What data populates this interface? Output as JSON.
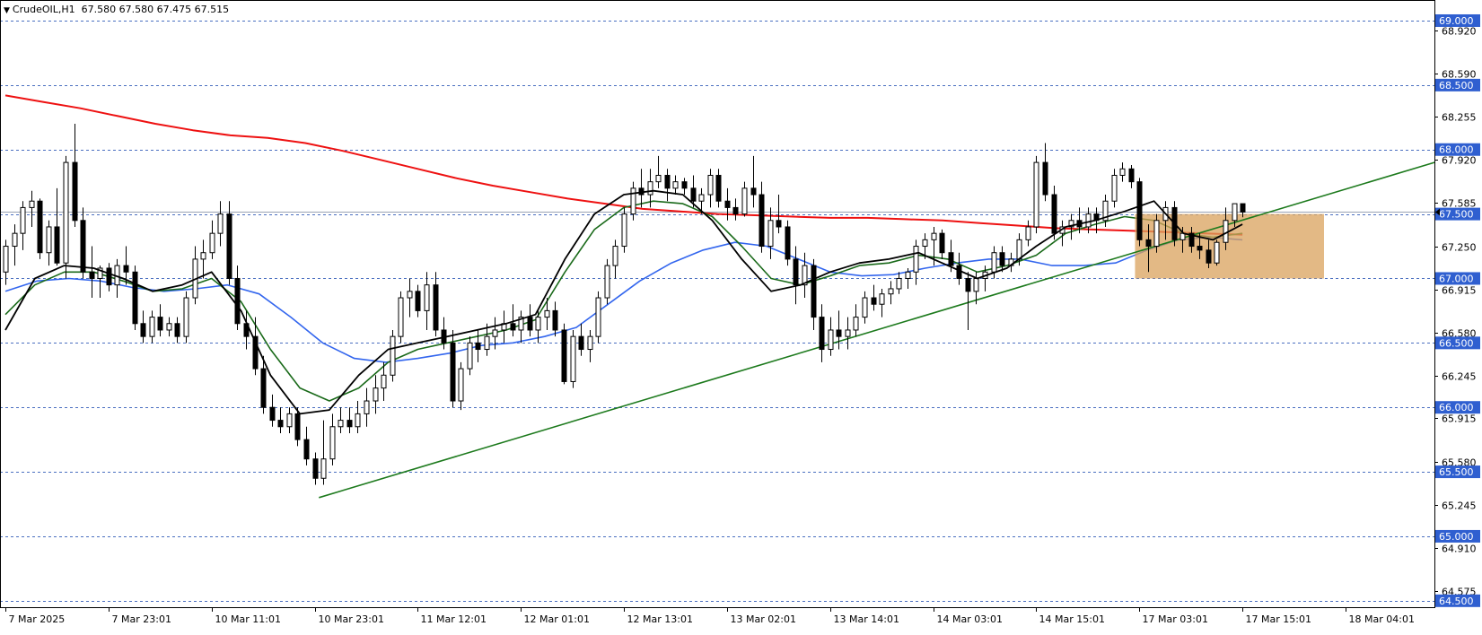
{
  "header": {
    "menu_arrow": "▼",
    "symbol_label": "CrudeOIL,H1",
    "ohlc": "67.580 67.580 67.475 67.515"
  },
  "colors": {
    "bull": "#ffffff",
    "bear": "#000000",
    "ma_red": "#ee1111",
    "ma_blue": "#3366ee",
    "ma_green": "#1a6a1a",
    "ma_black": "#000000",
    "trendline": "#1d7a1d",
    "zone": "#d9a15c",
    "grid_dash": "#4a6fc0",
    "badge": "#2f5fd0"
  },
  "chart_data": {
    "type": "candlestick",
    "symbol": "CrudeOIL",
    "timeframe": "H1",
    "ylim": [
      64.45,
      69.16
    ],
    "y_tick_labels": [
      "68.920",
      "68.590",
      "68.255",
      "67.920",
      "67.585",
      "67.250",
      "66.915",
      "66.580",
      "66.245",
      "65.915",
      "65.580",
      "65.245",
      "64.910",
      "64.575"
    ],
    "y_tick_values": [
      68.92,
      68.59,
      68.255,
      67.92,
      67.585,
      67.25,
      66.915,
      66.58,
      66.245,
      65.915,
      65.58,
      65.245,
      64.91,
      64.575
    ],
    "level_lines": [
      69.0,
      68.5,
      68.0,
      67.5,
      67.0,
      66.5,
      66.0,
      65.5,
      65.0,
      64.5
    ],
    "level_labels": [
      "69.000",
      "68.500",
      "68.000",
      "67.500",
      "67.000",
      "66.500",
      "66.000",
      "65.500",
      "65.000",
      "64.500"
    ],
    "current_price": 67.515,
    "x_labels": [
      "7 Mar 2025",
      "7 Mar 23:01",
      "10 Mar 11:01",
      "10 Mar 23:01",
      "11 Mar 12:01",
      "12 Mar 01:01",
      "12 Mar 13:01",
      "13 Mar 02:01",
      "13 Mar 14:01",
      "14 Mar 03:01",
      "14 Mar 15:01",
      "17 Mar 03:01",
      "17 Mar 15:01",
      "18 Mar 04:01"
    ],
    "x_label_bar_index": [
      0,
      12,
      24,
      36,
      48,
      60,
      72,
      84,
      96,
      108,
      120,
      132,
      144,
      156
    ],
    "candles": [
      [
        67.05,
        67.3,
        66.95,
        67.25
      ],
      [
        67.25,
        67.42,
        67.1,
        67.35
      ],
      [
        67.35,
        67.6,
        67.22,
        67.55
      ],
      [
        67.55,
        67.68,
        67.4,
        67.6
      ],
      [
        67.6,
        67.62,
        67.15,
        67.2
      ],
      [
        67.2,
        67.45,
        67.1,
        67.4
      ],
      [
        67.4,
        67.7,
        67.1,
        67.12
      ],
      [
        67.12,
        67.95,
        67.0,
        67.9
      ],
      [
        67.9,
        68.2,
        67.4,
        67.45
      ],
      [
        67.45,
        67.55,
        67.0,
        67.05
      ],
      [
        67.05,
        67.25,
        66.85,
        67.0
      ],
      [
        67.0,
        67.1,
        66.85,
        67.08
      ],
      [
        67.08,
        67.12,
        66.9,
        66.95
      ],
      [
        66.95,
        67.15,
        66.85,
        67.1
      ],
      [
        67.1,
        67.25,
        66.95,
        67.05
      ],
      [
        67.05,
        67.1,
        66.6,
        66.65
      ],
      [
        66.65,
        66.75,
        66.5,
        66.55
      ],
      [
        66.55,
        66.75,
        66.5,
        66.7
      ],
      [
        66.7,
        66.8,
        66.55,
        66.6
      ],
      [
        66.6,
        66.7,
        66.55,
        66.65
      ],
      [
        66.65,
        66.7,
        66.5,
        66.55
      ],
      [
        66.55,
        66.9,
        66.5,
        66.85
      ],
      [
        66.85,
        67.25,
        66.8,
        67.15
      ],
      [
        67.15,
        67.3,
        67.0,
        67.2
      ],
      [
        67.2,
        67.45,
        67.15,
        67.35
      ],
      [
        67.35,
        67.6,
        67.25,
        67.5
      ],
      [
        67.5,
        67.6,
        66.95,
        67.0
      ],
      [
        67.0,
        67.1,
        66.6,
        66.65
      ],
      [
        66.65,
        66.75,
        66.45,
        66.55
      ],
      [
        66.55,
        66.7,
        66.25,
        66.3
      ],
      [
        66.3,
        66.4,
        65.95,
        66.0
      ],
      [
        66.0,
        66.1,
        65.85,
        65.9
      ],
      [
        65.9,
        66.0,
        65.8,
        65.85
      ],
      [
        65.85,
        66.0,
        65.8,
        65.95
      ],
      [
        65.95,
        66.0,
        65.7,
        65.75
      ],
      [
        65.75,
        65.85,
        65.55,
        65.6
      ],
      [
        65.6,
        65.65,
        65.4,
        65.45
      ],
      [
        65.45,
        65.9,
        65.4,
        65.6
      ],
      [
        65.6,
        65.95,
        65.55,
        65.85
      ],
      [
        65.85,
        66.0,
        65.8,
        65.9
      ],
      [
        65.9,
        66.0,
        65.8,
        65.85
      ],
      [
        65.85,
        66.05,
        65.8,
        65.95
      ],
      [
        65.95,
        66.15,
        65.85,
        66.05
      ],
      [
        66.05,
        66.25,
        65.95,
        66.15
      ],
      [
        66.15,
        66.35,
        66.05,
        66.25
      ],
      [
        66.25,
        66.6,
        66.2,
        66.55
      ],
      [
        66.55,
        66.9,
        66.5,
        66.85
      ],
      [
        66.85,
        67.0,
        66.7,
        66.9
      ],
      [
        66.9,
        66.95,
        66.7,
        66.75
      ],
      [
        66.75,
        67.05,
        66.6,
        66.95
      ],
      [
        66.95,
        67.05,
        66.55,
        66.6
      ],
      [
        66.6,
        66.7,
        66.45,
        66.5
      ],
      [
        66.5,
        66.6,
        66.0,
        66.05
      ],
      [
        66.05,
        66.35,
        65.98,
        66.3
      ],
      [
        66.3,
        66.55,
        66.25,
        66.5
      ],
      [
        66.5,
        66.6,
        66.35,
        66.45
      ],
      [
        66.45,
        66.65,
        66.4,
        66.55
      ],
      [
        66.55,
        66.7,
        66.45,
        66.6
      ],
      [
        66.6,
        66.75,
        66.5,
        66.65
      ],
      [
        66.65,
        66.8,
        66.55,
        66.6
      ],
      [
        66.6,
        66.75,
        66.5,
        66.7
      ],
      [
        66.7,
        66.8,
        66.55,
        66.6
      ],
      [
        66.6,
        66.75,
        66.5,
        66.7
      ],
      [
        66.7,
        66.85,
        66.6,
        66.75
      ],
      [
        66.75,
        66.82,
        66.55,
        66.6
      ],
      [
        66.6,
        66.65,
        66.18,
        66.2
      ],
      [
        66.2,
        66.6,
        66.15,
        66.55
      ],
      [
        66.55,
        66.65,
        66.4,
        66.45
      ],
      [
        66.45,
        66.6,
        66.35,
        66.55
      ],
      [
        66.55,
        66.9,
        66.5,
        66.85
      ],
      [
        66.85,
        67.15,
        66.8,
        67.1
      ],
      [
        67.1,
        67.3,
        67.0,
        67.25
      ],
      [
        67.25,
        67.55,
        67.2,
        67.5
      ],
      [
        67.5,
        67.75,
        67.45,
        67.7
      ],
      [
        67.7,
        67.85,
        67.55,
        67.65
      ],
      [
        67.65,
        67.85,
        67.55,
        67.75
      ],
      [
        67.75,
        67.95,
        67.7,
        67.8
      ],
      [
        67.8,
        67.85,
        67.6,
        67.7
      ],
      [
        67.7,
        67.8,
        67.65,
        67.75
      ],
      [
        67.75,
        67.78,
        67.65,
        67.7
      ],
      [
        67.7,
        67.8,
        67.55,
        67.6
      ],
      [
        67.6,
        67.7,
        67.5,
        67.65
      ],
      [
        67.65,
        67.85,
        67.55,
        67.8
      ],
      [
        67.8,
        67.85,
        67.55,
        67.6
      ],
      [
        67.6,
        67.7,
        67.45,
        67.55
      ],
      [
        67.55,
        67.62,
        67.45,
        67.5
      ],
      [
        67.5,
        67.75,
        67.48,
        67.7
      ],
      [
        67.7,
        67.95,
        67.55,
        67.65
      ],
      [
        67.65,
        67.75,
        67.2,
        67.25
      ],
      [
        67.25,
        67.55,
        67.15,
        67.45
      ],
      [
        67.45,
        67.65,
        67.35,
        67.4
      ],
      [
        67.4,
        67.45,
        67.1,
        67.15
      ],
      [
        67.15,
        67.25,
        66.8,
        66.95
      ],
      [
        66.95,
        67.2,
        66.85,
        67.1
      ],
      [
        67.1,
        67.15,
        66.6,
        66.7
      ],
      [
        66.7,
        66.8,
        66.35,
        66.45
      ],
      [
        66.45,
        66.7,
        66.4,
        66.6
      ],
      [
        66.6,
        66.75,
        66.45,
        66.55
      ],
      [
        66.55,
        66.7,
        66.45,
        66.6
      ],
      [
        66.6,
        66.8,
        66.55,
        66.7
      ],
      [
        66.7,
        66.9,
        66.65,
        66.85
      ],
      [
        66.85,
        66.95,
        66.75,
        66.8
      ],
      [
        66.8,
        66.92,
        66.7,
        66.88
      ],
      [
        66.88,
        66.98,
        66.8,
        66.92
      ],
      [
        66.92,
        67.05,
        66.88,
        67.0
      ],
      [
        67.0,
        67.08,
        66.92,
        67.05
      ],
      [
        67.05,
        67.3,
        66.95,
        67.25
      ],
      [
        67.25,
        67.35,
        67.15,
        67.3
      ],
      [
        67.3,
        67.4,
        67.1,
        67.35
      ],
      [
        67.35,
        67.38,
        67.15,
        67.2
      ],
      [
        67.2,
        67.3,
        67.05,
        67.1
      ],
      [
        67.1,
        67.2,
        66.95,
        67.0
      ],
      [
        67.0,
        67.05,
        66.6,
        66.9
      ],
      [
        66.9,
        67.05,
        66.8,
        67.0
      ],
      [
        67.0,
        67.1,
        66.9,
        67.05
      ],
      [
        67.05,
        67.25,
        67.0,
        67.2
      ],
      [
        67.2,
        67.25,
        67.05,
        67.1
      ],
      [
        67.1,
        67.2,
        67.05,
        67.15
      ],
      [
        67.15,
        67.35,
        67.1,
        67.3
      ],
      [
        67.3,
        67.45,
        67.25,
        67.4
      ],
      [
        67.4,
        67.95,
        67.35,
        67.9
      ],
      [
        67.9,
        68.05,
        67.6,
        67.65
      ],
      [
        67.65,
        67.72,
        67.3,
        67.35
      ],
      [
        67.35,
        67.45,
        67.25,
        67.4
      ],
      [
        67.4,
        67.5,
        67.3,
        67.45
      ],
      [
        67.45,
        67.55,
        67.35,
        67.4
      ],
      [
        67.4,
        67.55,
        67.35,
        67.5
      ],
      [
        67.5,
        67.55,
        67.35,
        67.45
      ],
      [
        67.45,
        67.65,
        67.4,
        67.6
      ],
      [
        67.6,
        67.85,
        67.55,
        67.8
      ],
      [
        67.8,
        67.9,
        67.75,
        67.85
      ],
      [
        67.85,
        67.88,
        67.7,
        67.75
      ],
      [
        67.75,
        67.78,
        67.25,
        67.3
      ],
      [
        67.3,
        67.42,
        67.05,
        67.25
      ],
      [
        67.25,
        67.5,
        67.2,
        67.45
      ],
      [
        67.45,
        67.6,
        67.3,
        67.55
      ],
      [
        67.55,
        67.6,
        67.25,
        67.3
      ],
      [
        67.3,
        67.4,
        67.2,
        67.35
      ],
      [
        67.35,
        67.4,
        67.2,
        67.25
      ],
      [
        67.25,
        67.35,
        67.15,
        67.22
      ],
      [
        67.22,
        67.3,
        67.08,
        67.12
      ],
      [
        67.12,
        67.3,
        67.1,
        67.28
      ],
      [
        67.28,
        67.55,
        67.22,
        67.45
      ],
      [
        67.45,
        67.58,
        67.4,
        67.58
      ],
      [
        67.58,
        67.58,
        67.475,
        67.515
      ]
    ],
    "moving_averages": [
      {
        "color": "red",
        "values": [
          68.42,
          68.37,
          68.32,
          68.26,
          68.2,
          68.15,
          68.11,
          68.09,
          68.05,
          67.99,
          67.92,
          67.85,
          67.78,
          67.72,
          67.67,
          67.62,
          67.58,
          67.54,
          67.52,
          67.5,
          67.49,
          67.48,
          67.47,
          67.47,
          67.46,
          67.45,
          67.43,
          67.41,
          67.39,
          67.38,
          67.37,
          67.36,
          67.35,
          67.34
        ]
      },
      {
        "color": "blue",
        "values": [
          66.9,
          66.98,
          67.0,
          66.98,
          66.93,
          66.9,
          66.92,
          66.95,
          66.88,
          66.7,
          66.5,
          66.38,
          66.35,
          66.38,
          66.42,
          66.48,
          66.5,
          66.55,
          66.62,
          66.8,
          66.98,
          67.12,
          67.22,
          67.28,
          67.25,
          67.15,
          67.05,
          67.02,
          67.03,
          67.08,
          67.12,
          67.15,
          67.15,
          67.1,
          67.1,
          67.12,
          67.22,
          67.3,
          67.32,
          67.3
        ]
      },
      {
        "color": "green",
        "values": [
          66.72,
          66.95,
          67.05,
          67.05,
          66.98,
          66.9,
          66.92,
          67.0,
          66.82,
          66.45,
          66.15,
          66.05,
          66.15,
          66.35,
          66.45,
          66.5,
          66.55,
          66.6,
          66.68,
          67.05,
          67.38,
          67.55,
          67.6,
          67.58,
          67.48,
          67.25,
          67.0,
          66.95,
          67.02,
          67.1,
          67.12,
          67.18,
          67.15,
          67.05,
          67.1,
          67.18,
          67.35,
          67.42,
          67.48,
          67.45,
          67.35,
          67.32,
          67.35
        ]
      },
      {
        "color": "black",
        "values": [
          66.6,
          67.0,
          67.1,
          67.08,
          67.0,
          66.9,
          66.95,
          67.05,
          66.75,
          66.25,
          65.95,
          65.98,
          66.25,
          66.45,
          66.5,
          66.55,
          66.6,
          66.65,
          66.72,
          67.15,
          67.5,
          67.65,
          67.68,
          67.65,
          67.45,
          67.15,
          66.9,
          66.95,
          67.05,
          67.12,
          67.15,
          67.2,
          67.1,
          67.0,
          67.08,
          67.25,
          67.4,
          67.45,
          67.52,
          67.6,
          67.35,
          67.3,
          67.42
        ]
      }
    ],
    "trendline": {
      "start": [
        36.5,
        65.3
      ],
      "end": [
        203,
        67.9
      ]
    },
    "zone": {
      "x": [
        131.5,
        153.5
      ],
      "y": [
        67.0,
        67.5
      ]
    }
  }
}
